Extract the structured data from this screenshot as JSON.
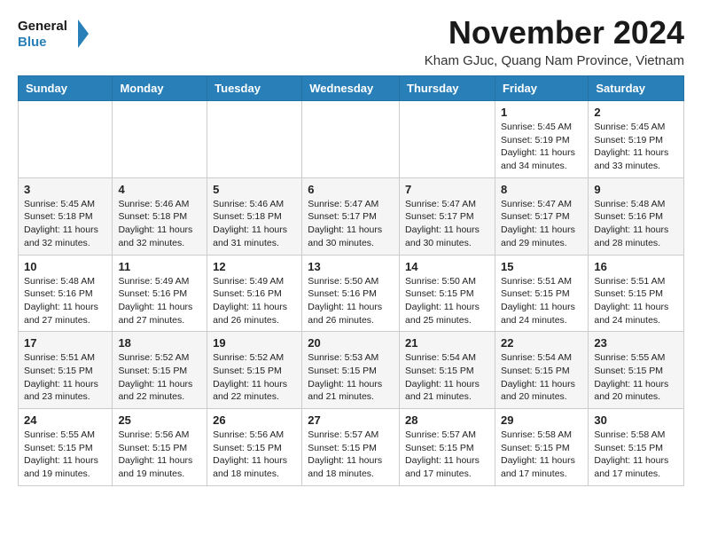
{
  "header": {
    "logo_line1": "General",
    "logo_line2": "Blue",
    "month_title": "November 2024",
    "location": "Kham GJuc, Quang Nam Province, Vietnam"
  },
  "weekdays": [
    "Sunday",
    "Monday",
    "Tuesday",
    "Wednesday",
    "Thursday",
    "Friday",
    "Saturday"
  ],
  "weeks": [
    [
      {
        "day": "",
        "info": ""
      },
      {
        "day": "",
        "info": ""
      },
      {
        "day": "",
        "info": ""
      },
      {
        "day": "",
        "info": ""
      },
      {
        "day": "",
        "info": ""
      },
      {
        "day": "1",
        "info": "Sunrise: 5:45 AM\nSunset: 5:19 PM\nDaylight: 11 hours\nand 34 minutes."
      },
      {
        "day": "2",
        "info": "Sunrise: 5:45 AM\nSunset: 5:19 PM\nDaylight: 11 hours\nand 33 minutes."
      }
    ],
    [
      {
        "day": "3",
        "info": "Sunrise: 5:45 AM\nSunset: 5:18 PM\nDaylight: 11 hours\nand 32 minutes."
      },
      {
        "day": "4",
        "info": "Sunrise: 5:46 AM\nSunset: 5:18 PM\nDaylight: 11 hours\nand 32 minutes."
      },
      {
        "day": "5",
        "info": "Sunrise: 5:46 AM\nSunset: 5:18 PM\nDaylight: 11 hours\nand 31 minutes."
      },
      {
        "day": "6",
        "info": "Sunrise: 5:47 AM\nSunset: 5:17 PM\nDaylight: 11 hours\nand 30 minutes."
      },
      {
        "day": "7",
        "info": "Sunrise: 5:47 AM\nSunset: 5:17 PM\nDaylight: 11 hours\nand 30 minutes."
      },
      {
        "day": "8",
        "info": "Sunrise: 5:47 AM\nSunset: 5:17 PM\nDaylight: 11 hours\nand 29 minutes."
      },
      {
        "day": "9",
        "info": "Sunrise: 5:48 AM\nSunset: 5:16 PM\nDaylight: 11 hours\nand 28 minutes."
      }
    ],
    [
      {
        "day": "10",
        "info": "Sunrise: 5:48 AM\nSunset: 5:16 PM\nDaylight: 11 hours\nand 27 minutes."
      },
      {
        "day": "11",
        "info": "Sunrise: 5:49 AM\nSunset: 5:16 PM\nDaylight: 11 hours\nand 27 minutes."
      },
      {
        "day": "12",
        "info": "Sunrise: 5:49 AM\nSunset: 5:16 PM\nDaylight: 11 hours\nand 26 minutes."
      },
      {
        "day": "13",
        "info": "Sunrise: 5:50 AM\nSunset: 5:16 PM\nDaylight: 11 hours\nand 26 minutes."
      },
      {
        "day": "14",
        "info": "Sunrise: 5:50 AM\nSunset: 5:15 PM\nDaylight: 11 hours\nand 25 minutes."
      },
      {
        "day": "15",
        "info": "Sunrise: 5:51 AM\nSunset: 5:15 PM\nDaylight: 11 hours\nand 24 minutes."
      },
      {
        "day": "16",
        "info": "Sunrise: 5:51 AM\nSunset: 5:15 PM\nDaylight: 11 hours\nand 24 minutes."
      }
    ],
    [
      {
        "day": "17",
        "info": "Sunrise: 5:51 AM\nSunset: 5:15 PM\nDaylight: 11 hours\nand 23 minutes."
      },
      {
        "day": "18",
        "info": "Sunrise: 5:52 AM\nSunset: 5:15 PM\nDaylight: 11 hours\nand 22 minutes."
      },
      {
        "day": "19",
        "info": "Sunrise: 5:52 AM\nSunset: 5:15 PM\nDaylight: 11 hours\nand 22 minutes."
      },
      {
        "day": "20",
        "info": "Sunrise: 5:53 AM\nSunset: 5:15 PM\nDaylight: 11 hours\nand 21 minutes."
      },
      {
        "day": "21",
        "info": "Sunrise: 5:54 AM\nSunset: 5:15 PM\nDaylight: 11 hours\nand 21 minutes."
      },
      {
        "day": "22",
        "info": "Sunrise: 5:54 AM\nSunset: 5:15 PM\nDaylight: 11 hours\nand 20 minutes."
      },
      {
        "day": "23",
        "info": "Sunrise: 5:55 AM\nSunset: 5:15 PM\nDaylight: 11 hours\nand 20 minutes."
      }
    ],
    [
      {
        "day": "24",
        "info": "Sunrise: 5:55 AM\nSunset: 5:15 PM\nDaylight: 11 hours\nand 19 minutes."
      },
      {
        "day": "25",
        "info": "Sunrise: 5:56 AM\nSunset: 5:15 PM\nDaylight: 11 hours\nand 19 minutes."
      },
      {
        "day": "26",
        "info": "Sunrise: 5:56 AM\nSunset: 5:15 PM\nDaylight: 11 hours\nand 18 minutes."
      },
      {
        "day": "27",
        "info": "Sunrise: 5:57 AM\nSunset: 5:15 PM\nDaylight: 11 hours\nand 18 minutes."
      },
      {
        "day": "28",
        "info": "Sunrise: 5:57 AM\nSunset: 5:15 PM\nDaylight: 11 hours\nand 17 minutes."
      },
      {
        "day": "29",
        "info": "Sunrise: 5:58 AM\nSunset: 5:15 PM\nDaylight: 11 hours\nand 17 minutes."
      },
      {
        "day": "30",
        "info": "Sunrise: 5:58 AM\nSunset: 5:15 PM\nDaylight: 11 hours\nand 17 minutes."
      }
    ]
  ]
}
